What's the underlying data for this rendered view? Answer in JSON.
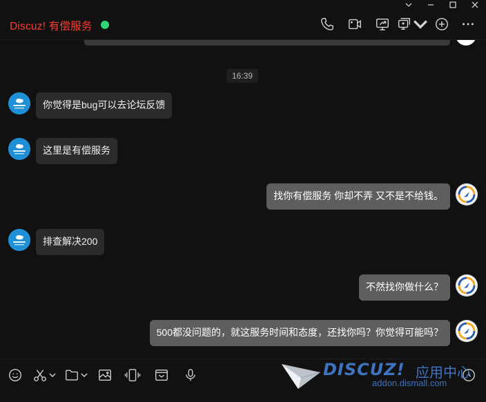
{
  "window": {
    "controls": [
      "chevron-down",
      "minimize",
      "maximize",
      "close"
    ]
  },
  "header": {
    "title": "Discuz! 有偿服务",
    "online_color": "#2ed573",
    "title_color": "#ff3b30",
    "icons": [
      "phone-icon",
      "video-call-icon",
      "screen-share-icon",
      "remote-assist-icon",
      "add-member-icon",
      "more-icon"
    ]
  },
  "chat": {
    "timestamp": "16:39",
    "messages": [
      {
        "side": "in",
        "text": "你觉得是bug可以去论坛反馈"
      },
      {
        "side": "in",
        "text": "这里是有偿服务"
      },
      {
        "side": "out",
        "text": "找你有偿服务 你却不弄  又不是不给钱。"
      },
      {
        "side": "in",
        "text": "排查解决200"
      },
      {
        "side": "out",
        "text": "不然找你做什么？"
      },
      {
        "side": "out",
        "text": "500都没问题的，就这服务时间和态度，还找你吗？你觉得可能吗？"
      }
    ]
  },
  "toolbar": {
    "icons": [
      "emoji-icon",
      "screenshot-scissors-icon",
      "folder-icon",
      "image-icon",
      "shake-icon",
      "envelope-icon",
      "microphone-icon",
      "history-icon"
    ]
  },
  "watermark": {
    "brand": "DISCUZ!",
    "cn": "应用中心",
    "url": "addon.dismall.com",
    "color": "#3f74c2"
  }
}
